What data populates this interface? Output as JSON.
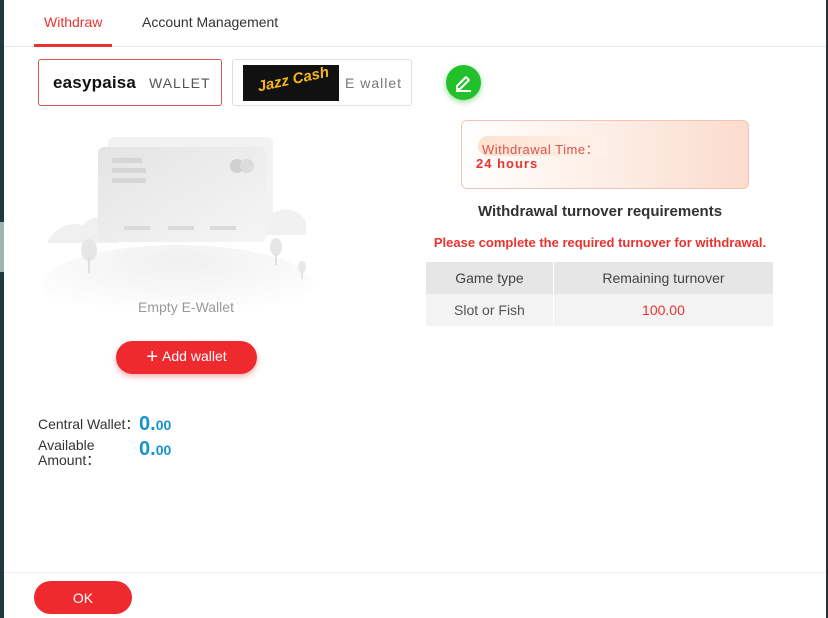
{
  "tabs": [
    {
      "label": "Withdraw",
      "active": true
    },
    {
      "label": "Account Management",
      "active": false
    }
  ],
  "wallets": [
    {
      "logo_text": "easypaisa",
      "type_label": "WALLET",
      "selected": true
    },
    {
      "logo_text": "Jazz Cash",
      "type_label": "E wallet",
      "selected": false
    }
  ],
  "edit_icon": "pencil-icon",
  "empty_wallet": {
    "text": "Empty E-Wallet",
    "add_button_label": "Add wallet"
  },
  "balances": {
    "central_label": "Central Wallet：",
    "central_int": "0.",
    "central_dec": "00",
    "available_label": "Available Amount：",
    "available_int": "0.",
    "available_dec": "00"
  },
  "withdrawal_time": {
    "label": "Withdrawal Time：",
    "value": "24 hours"
  },
  "turnover": {
    "title": "Withdrawal turnover requirements",
    "warning": "Please complete the required turnover for withdrawal.",
    "columns": [
      "Game type",
      "Remaining turnover"
    ],
    "rows": [
      {
        "game_type": "Slot or Fish",
        "remaining": "100.00"
      }
    ]
  },
  "footer": {
    "ok_label": "OK"
  },
  "colors": {
    "accent": "#e8332f",
    "value_blue": "#1594cf",
    "edit_green": "#22c02a"
  }
}
